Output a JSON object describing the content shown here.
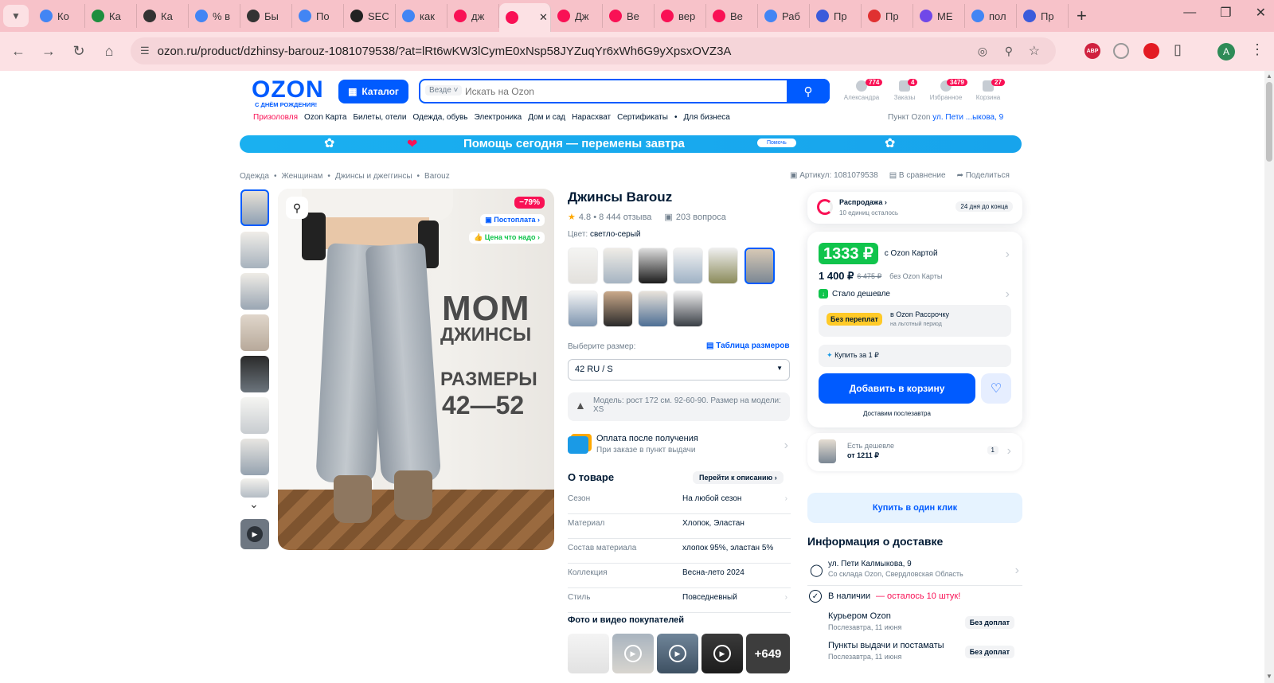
{
  "browser": {
    "tabs": [
      {
        "label": "Ко",
        "icon": "google-icon",
        "color": "#4285f4"
      },
      {
        "label": "Ка",
        "icon": "play-icon",
        "color": "#1e8e3e"
      },
      {
        "label": "Ка",
        "icon": "ring-icon",
        "color": "#333333"
      },
      {
        "label": "% в",
        "icon": "google-icon",
        "color": "#4285f4"
      },
      {
        "label": "Бы",
        "icon": "ring-icon",
        "color": "#333333"
      },
      {
        "label": "По",
        "icon": "google-icon",
        "color": "#4285f4"
      },
      {
        "label": "SEC",
        "icon": "w-icon",
        "color": "#222222"
      },
      {
        "label": "как",
        "icon": "google-icon",
        "color": "#4285f4"
      },
      {
        "label": "дж",
        "icon": "ozon-icon",
        "color": "#f91155"
      },
      {
        "label": "",
        "icon": "ozon-icon",
        "color": "#f91155"
      },
      {
        "label": "Дж",
        "icon": "ozon-icon",
        "color": "#f91155"
      },
      {
        "label": "Ве",
        "icon": "ozon-icon",
        "color": "#f91155"
      },
      {
        "label": "вер",
        "icon": "ozon-icon",
        "color": "#f91155"
      },
      {
        "label": "Ве",
        "icon": "ozon-icon",
        "color": "#f91155"
      },
      {
        "label": "Раб",
        "icon": "google-icon",
        "color": "#4285f4"
      },
      {
        "label": "Пр",
        "icon": "moon-icon",
        "color": "#3b5bdb"
      },
      {
        "label": "Пр",
        "icon": "question-icon",
        "color": "#e03131"
      },
      {
        "label": "МЕ",
        "icon": "puzzle-icon",
        "color": "#7048e8"
      },
      {
        "label": "пол",
        "icon": "google-icon",
        "color": "#4285f4"
      },
      {
        "label": "Пр",
        "icon": "moon-icon",
        "color": "#3b5bdb"
      }
    ],
    "url": "ozon.ru/product/dzhinsy-barouz-1081079538/?at=lRt6wKW3lCymE0xNsp58JYZuqYr6xWh6G9yXpsxOVZ3A",
    "avatar_letter": "A",
    "abp_label": "ABP"
  },
  "header": {
    "logo": "OZON",
    "logo_sub": "С ДНЁМ РОЖДЕНИЯ!",
    "catalog": "Каталог",
    "search_scope": "Везде",
    "search_placeholder": "Искать на Ozon",
    "user": {
      "label": "Александра",
      "badge": "774"
    },
    "orders": {
      "label": "Заказы",
      "badge": "4"
    },
    "favorites": {
      "label": "Избранное",
      "badge": "3479"
    },
    "cart": {
      "label": "Корзина",
      "badge": "27"
    }
  },
  "nav": {
    "items": [
      "Призоловля",
      "Ozon Карта",
      "Билеты, отели",
      "Одежда, обувь",
      "Электроника",
      "Дом и сад",
      "Нарасхват",
      "Сертификаты",
      "•",
      "Для бизнеса"
    ],
    "pickup_label": "Пункт Ozon",
    "pickup_address": "ул. Пети ...ыкова, 9"
  },
  "banner": {
    "text": "Помощь сегодня — перемены завтра",
    "button": "Помочь"
  },
  "breadcrumbs": [
    "Одежда",
    "Женщинам",
    "Джинсы и джеггинсы",
    "Barouz"
  ],
  "meta": {
    "article": "Артикул: 1081079538",
    "compare": "В сравнение",
    "share": "Поделиться"
  },
  "gallery": {
    "discount": "−79%",
    "tag1": "Постоплата",
    "tag2": "Цена что надо",
    "big_title": "MOM",
    "big_sub": "ДЖИНСЫ",
    "sizes_title": "РАЗМЕРЫ",
    "sizes_range": "42—52"
  },
  "product": {
    "title": "Джинсы Barouz",
    "rating": "4.8 • 8 444 отзыва",
    "questions": "203 вопроса",
    "color_label": "Цвет:",
    "color_value": "светло-серый",
    "size_label": "Выберите размер:",
    "size_table": "Таблица размеров",
    "size_value": "42 RU / S",
    "model_info": "Модель: рост 172 см. 92-60-90. Размер на модели: XS",
    "payment_title": "Оплата после получения",
    "payment_sub": "При заказе в пункт выдачи"
  },
  "about": {
    "title": "О товаре",
    "link": "Перейти к описанию",
    "props": [
      {
        "name": "Сезон",
        "value": "На любой сезон"
      },
      {
        "name": "Материал",
        "value": "Хлопок, Эластан"
      },
      {
        "name": "Состав материала",
        "value": "хлопок 95%, эластан 5%"
      },
      {
        "name": "Коллекция",
        "value": "Весна-лето 2024"
      },
      {
        "name": "Стиль",
        "value": "Повседневный"
      }
    ],
    "photos_title": "Фото и видео покупателей",
    "photos_more": "+649"
  },
  "sale": {
    "title": "Распродажа",
    "sub": "10 единиц осталось",
    "days": "24 дня до конца"
  },
  "price": {
    "card_price": "1333 ₽",
    "card_label": "с Ozon Картой",
    "regular_price": "1 400 ₽",
    "old_price": "6 475 ₽",
    "regular_label": "без Ozon Карты",
    "cheaper": "Стало дешевле",
    "installment_badge": "Без переплат",
    "installment_title": "в Ozon Рассрочку",
    "installment_sub": "на льготный период",
    "buy_for_one": "Купить за 1 ₽",
    "add_to_cart": "Добавить в корзину",
    "delivery_note": "Доставим послезавтра"
  },
  "cheaper_offer": {
    "title": "Есть дешевле",
    "price": "от 1211 ₽",
    "count": "1"
  },
  "one_click": "Купить в один клик",
  "delivery": {
    "title": "Информация о доставке",
    "address": "ул. Пети Калмыкова, 9",
    "address_sub": "Со склада Ozon, Свердловская Область",
    "stock": "В наличии",
    "stock_left": "— осталось 10 штук!",
    "courier": "Курьером Ozon",
    "courier_date": "Послезавтра, 11 июня",
    "courier_price": "Без доплат",
    "points": "Пункты выдачи и постаматы",
    "points_date": "Послезавтра, 11 июня",
    "points_price": "Без доплат"
  },
  "colors": {
    "ozon_blue": "#005bff",
    "ozon_pink": "#f91155",
    "green": "#10c44c",
    "tab_bg": "#f7c2c9"
  }
}
